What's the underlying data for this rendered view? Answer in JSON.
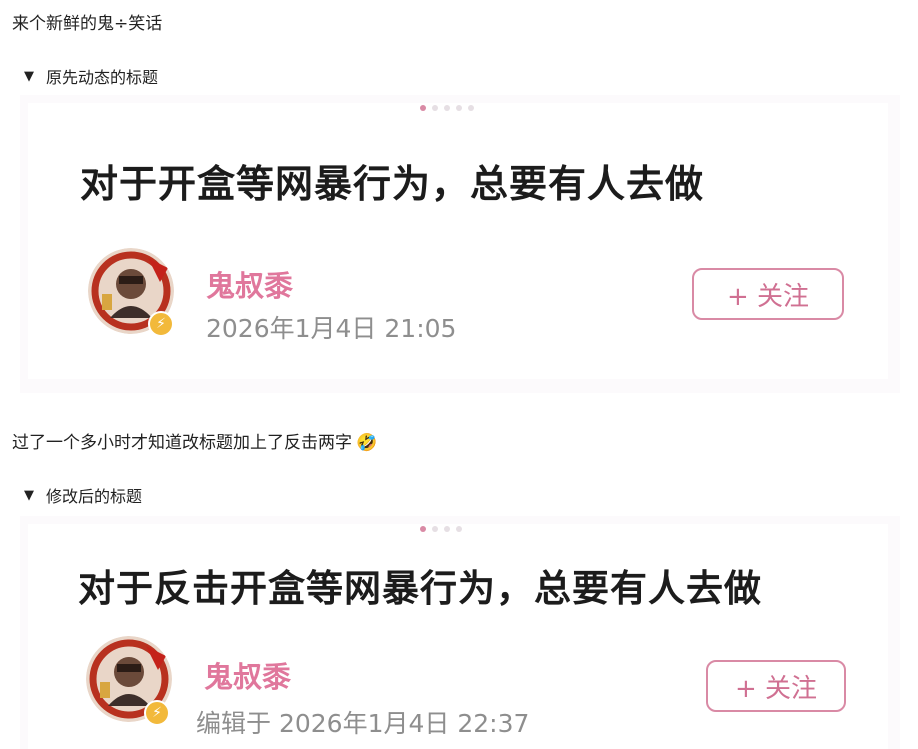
{
  "post": {
    "intro_text": "来个新鲜的鬼÷笑话",
    "between_text": "过了一个多小时才知道改标题加上了反击两字",
    "emoji": "🤣"
  },
  "sections": [
    {
      "summary": "原先动态的标题",
      "toggle_icon": "▼",
      "headline": "对于开盒等网暴行为，总要有人去做",
      "author": "鬼叔黍",
      "timestamp": "2026年1月4日 21:05",
      "follow_label": "+ 关注",
      "verify_icon": "⚡"
    },
    {
      "summary": "修改后的标题",
      "toggle_icon": "▼",
      "headline": "对于反击开盒等网暴行为，总要有人去做",
      "author": "鬼叔黍",
      "timestamp": "编辑于 2026年1月4日 22:37",
      "follow_label": "+ 关注",
      "verify_icon": "⚡"
    }
  ],
  "colors": {
    "author": "#e0779c",
    "follow_border": "#d98aa5",
    "verify_badge": "#f2b93b",
    "timestamp": "#8e8e8e"
  }
}
